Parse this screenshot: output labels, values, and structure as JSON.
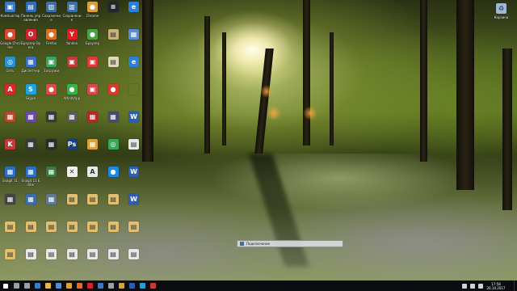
{
  "desktop_icons": [
    {
      "label": "Компьютер",
      "glyph": "▣",
      "color": "#3a78c2"
    },
    {
      "label": "Панель управления",
      "glyph": "▤",
      "color": "#2f6db5"
    },
    {
      "label": "Сохранение",
      "glyph": "▥",
      "color": "#3a6fa8"
    },
    {
      "label": "Сохранение",
      "glyph": "▥",
      "color": "#3a6fa8"
    },
    {
      "label": "Chrome",
      "glyph": "●",
      "color": "#d8a13a"
    },
    {
      "label": "",
      "glyph": "≡",
      "color": "#22272e"
    },
    {
      "label": "",
      "glyph": "e",
      "color": "#2a7fd8"
    },
    {
      "label": "Google Chrome",
      "glyph": "●",
      "color": "#d64a2e"
    },
    {
      "label": "Браузер Opera",
      "glyph": "O",
      "color": "#d02330"
    },
    {
      "label": "Firefox",
      "glyph": "●",
      "color": "#e66b1f"
    },
    {
      "label": "Yandex",
      "glyph": "Y",
      "color": "#e31b23"
    },
    {
      "label": "Браузер",
      "glyph": "●",
      "color": "#4aa14a"
    },
    {
      "label": "",
      "glyph": "▤",
      "color": "#c9b27a"
    },
    {
      "label": "",
      "glyph": "▦",
      "color": "#5b8bd6"
    },
    {
      "label": "Сеть",
      "glyph": "◎",
      "color": "#2b8fd0"
    },
    {
      "label": "Диспетчер",
      "glyph": "▦",
      "color": "#3b6ec4"
    },
    {
      "label": "Загрузки",
      "glyph": "▣",
      "color": "#3ba55c"
    },
    {
      "label": "",
      "glyph": "▣",
      "color": "#c23a3a"
    },
    {
      "label": "",
      "glyph": "▣",
      "color": "#d93c3c"
    },
    {
      "label": "",
      "glyph": "▤",
      "color": "#e0d8b8"
    },
    {
      "label": "",
      "glyph": "e",
      "color": "#2a7fd8"
    },
    {
      "label": "",
      "glyph": "A",
      "color": "#d32a2a"
    },
    {
      "label": "Skype",
      "glyph": "S",
      "color": "#1ea1e0"
    },
    {
      "label": "",
      "glyph": "●",
      "color": "#e34848"
    },
    {
      "label": "WhatsApp",
      "glyph": "●",
      "color": "#36b24a"
    },
    {
      "label": "",
      "glyph": "▣",
      "color": "#d24a4a"
    },
    {
      "label": "",
      "glyph": "●",
      "color": "#d83d2b"
    },
    {
      "label": "",
      "glyph": "",
      "color": "rgba(0,0,0,0)"
    },
    {
      "label": "",
      "glyph": "▦",
      "color": "#b24a2b"
    },
    {
      "label": "",
      "glyph": "▦",
      "color": "#6a4aa2"
    },
    {
      "label": "",
      "glyph": "▦",
      "color": "#3a3a3a"
    },
    {
      "label": "",
      "glyph": "▦",
      "color": "#5a5a5a"
    },
    {
      "label": "",
      "glyph": "▦",
      "color": "#b22b2b"
    },
    {
      "label": "",
      "glyph": "▦",
      "color": "#4a4a6a"
    },
    {
      "label": "",
      "glyph": "W",
      "color": "#2b5fb4"
    },
    {
      "label": "",
      "glyph": "K",
      "color": "#c23a3a"
    },
    {
      "label": "",
      "glyph": "▦",
      "color": "#3a3a3a"
    },
    {
      "label": "",
      "glyph": "▦",
      "color": "#2b2b2b"
    },
    {
      "label": "",
      "glyph": "Ps",
      "color": "#1b3f7a"
    },
    {
      "label": "",
      "glyph": "▦",
      "color": "#d8a13a"
    },
    {
      "label": "",
      "glyph": "◎",
      "color": "#3ba55c"
    },
    {
      "label": "",
      "glyph": "▤",
      "color": "#e8e8e8"
    },
    {
      "label": "Snagit 11",
      "glyph": "▦",
      "color": "#2b6fc2"
    },
    {
      "label": "Snagit 11 Editor",
      "glyph": "▦",
      "color": "#2b6fc2"
    },
    {
      "label": "",
      "glyph": "▦",
      "color": "#3a7a3a"
    },
    {
      "label": "",
      "glyph": "✕",
      "color": "#f0f0f0"
    },
    {
      "label": "",
      "glyph": "A",
      "color": "#e8e8e8"
    },
    {
      "label": "",
      "glyph": "●",
      "color": "#1e88e5"
    },
    {
      "label": "",
      "glyph": "W",
      "color": "#2b5fb4"
    },
    {
      "label": "",
      "glyph": "▦",
      "color": "#444"
    },
    {
      "label": "",
      "glyph": "▦",
      "color": "#3a6ea5"
    },
    {
      "label": "",
      "glyph": "▦",
      "color": "#5a7a9a"
    },
    {
      "label": "",
      "glyph": "▤",
      "color": "#e0c070"
    },
    {
      "label": "",
      "glyph": "▤",
      "color": "#e0c070"
    },
    {
      "label": "",
      "glyph": "▤",
      "color": "#e0c070"
    },
    {
      "label": "",
      "glyph": "W",
      "color": "#2b5fb4"
    },
    {
      "label": "",
      "glyph": "▤",
      "color": "#e0c070"
    },
    {
      "label": "",
      "glyph": "▤",
      "color": "#e0c070"
    },
    {
      "label": "",
      "glyph": "▤",
      "color": "#e0c070"
    },
    {
      "label": "",
      "glyph": "▤",
      "color": "#e0c070"
    },
    {
      "label": "",
      "glyph": "▤",
      "color": "#e0c070"
    },
    {
      "label": "",
      "glyph": "▤",
      "color": "#e0c070"
    },
    {
      "label": "",
      "glyph": "▤",
      "color": "#e0c070"
    },
    {
      "label": "",
      "glyph": "▤",
      "color": "#e0c070"
    },
    {
      "label": "",
      "glyph": "▤",
      "color": "#e8e8e8"
    },
    {
      "label": "",
      "glyph": "▤",
      "color": "#e8e8e8"
    },
    {
      "label": "",
      "glyph": "▤",
      "color": "#e8e8e8"
    },
    {
      "label": "",
      "glyph": "▤",
      "color": "#e8e8e8"
    },
    {
      "label": "",
      "glyph": "▤",
      "color": "#e8e8e8"
    },
    {
      "label": "",
      "glyph": "▤",
      "color": "#e8e8e8"
    }
  ],
  "recycle_bin": {
    "label": "Корзина",
    "glyph": "♻",
    "color": "#9fb7d0"
  },
  "notification": {
    "text": "Подключение"
  },
  "taskbar": {
    "buttons": [
      {
        "name": "start-button",
        "color": "#ffffff"
      },
      {
        "name": "search-button",
        "color": "#9aa0a8"
      },
      {
        "name": "task-view-button",
        "color": "#9aa0a8"
      },
      {
        "name": "edge-button",
        "color": "#2a7fd8"
      },
      {
        "name": "explorer-button",
        "color": "#e8b64a"
      },
      {
        "name": "store-button",
        "color": "#4a90d9"
      },
      {
        "name": "chrome-button",
        "color": "#d8a13a"
      },
      {
        "name": "firefox-button",
        "color": "#e66b1f"
      },
      {
        "name": "opera-button",
        "color": "#d02330"
      },
      {
        "name": "mail-button",
        "color": "#3a78c2"
      },
      {
        "name": "settings-button",
        "color": "#9aa0a8"
      },
      {
        "name": "media-button",
        "color": "#d8a13a"
      },
      {
        "name": "word-button",
        "color": "#2b5fb4"
      },
      {
        "name": "skype-button",
        "color": "#1ea1e0"
      },
      {
        "name": "app-button",
        "color": "#c23a3a"
      }
    ],
    "tray_icons": [
      {
        "name": "network-icon",
        "color": "#cfd3d8"
      },
      {
        "name": "volume-icon",
        "color": "#cfd3d8"
      },
      {
        "name": "language-icon",
        "color": "#cfd3d8"
      }
    ],
    "clock": {
      "time": "17:58",
      "date": "26.10.2017"
    }
  },
  "colors": {
    "taskbar": "#0b0c10",
    "accent": "#2a7fd8"
  }
}
